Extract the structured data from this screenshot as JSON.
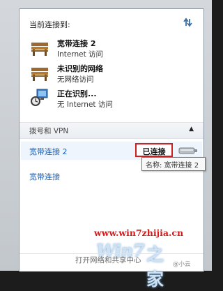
{
  "header": {
    "label": "当前连接到:",
    "refresh_icon": "refresh-icon"
  },
  "current_connections": [
    {
      "name": "宽带连接 2",
      "status": "Internet 访问",
      "icon": "bench-network-icon"
    },
    {
      "name": "未识别的网络",
      "status": "无网络访问",
      "icon": "bench-network-icon"
    },
    {
      "name": "正在识别...",
      "status": "无 Internet 访问",
      "icon": "identifying-network-icon"
    }
  ],
  "vpn_section": {
    "title": "拨号和 VPN",
    "collapse_icon": "chevron-up-icon",
    "items": [
      {
        "name": "宽带连接 2",
        "status": "已连接",
        "icon": "modem-plug-icon"
      },
      {
        "name": "宽带连接"
      }
    ]
  },
  "tooltip": {
    "text": "名称: 宽带连接 2"
  },
  "watermark": {
    "url": "www.win7zhijia.cn",
    "logo_text": "Win7",
    "logo_suffix": "之家"
  },
  "footer": {
    "open_link": "打开网络和共享中心",
    "credit": "@小云"
  },
  "colors": {
    "highlight_border": "#d01f1f",
    "link": "#1a5fb4",
    "accent_row": "#eef5fc"
  }
}
